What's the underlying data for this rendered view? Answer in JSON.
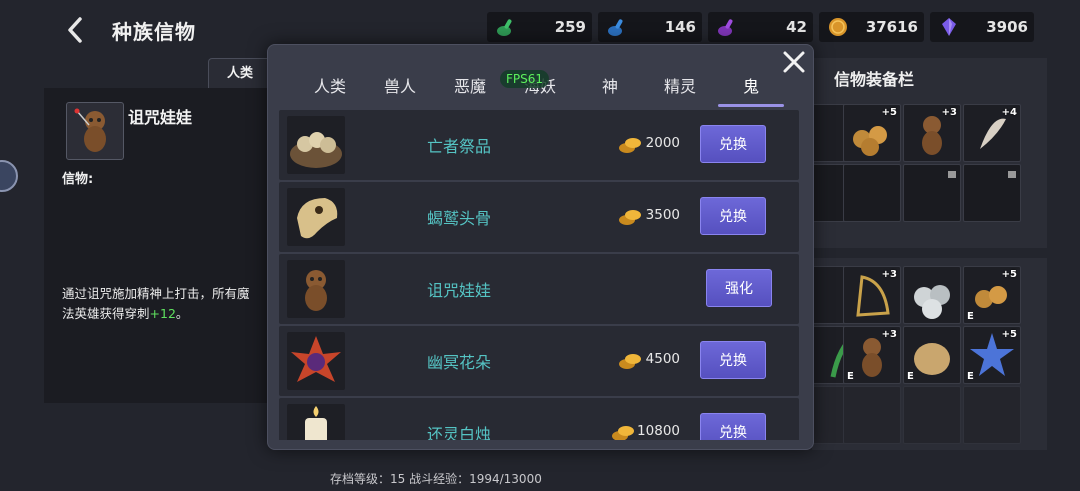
{
  "header": {
    "title": "种族信物"
  },
  "resources": [
    {
      "icon": "green-potion-icon",
      "value": "259",
      "color": "#3fbf6a"
    },
    {
      "icon": "blue-potion-icon",
      "value": "146",
      "color": "#3c8de0"
    },
    {
      "icon": "purple-potion-icon",
      "value": "42",
      "color": "#a04de0"
    },
    {
      "icon": "gold-coin-icon",
      "value": "37616",
      "color": "#d9952a"
    },
    {
      "icon": "purple-crystal-icon",
      "value": "3906",
      "color": "#7a5ce8"
    }
  ],
  "left": {
    "tab_label": "人类",
    "item_name": "诅咒娃娃",
    "label": "信物:",
    "description": "通过诅咒施加精神上打击，所有魔法英雄获得穿刺",
    "bonus": "+12",
    "desc_end": "。"
  },
  "right": {
    "equip_title": "信物装备栏",
    "equip_badges": [
      "+5",
      "+5",
      "+3",
      "+4"
    ],
    "inv_badges": [
      "+4",
      "+3",
      "",
      "+5",
      "",
      "+3",
      "",
      "+5"
    ],
    "inv_e_marks": [
      "",
      "",
      "",
      "E",
      "",
      "E",
      "E",
      "E"
    ]
  },
  "modal": {
    "tabs": [
      "人类",
      "兽人",
      "恶魔",
      "海妖",
      "神",
      "精灵",
      "鬼"
    ],
    "active_tab": "鬼",
    "fps_label": "FPS61",
    "items": [
      {
        "name": "亡者祭品",
        "price": "2000",
        "action": "兑换",
        "icon": "skull-bowl-icon"
      },
      {
        "name": "蝎鹫头骨",
        "price": "3500",
        "action": "兑换",
        "icon": "beast-skull-icon"
      },
      {
        "name": "诅咒娃娃",
        "price": "",
        "action": "强化",
        "icon": "voodoo-doll-icon"
      },
      {
        "name": "幽冥花朵",
        "price": "4500",
        "action": "兑换",
        "icon": "dark-flower-icon"
      },
      {
        "name": "还灵白烛",
        "price": "10800",
        "action": "兑换",
        "icon": "white-candle-icon"
      }
    ]
  },
  "footer": {
    "text": "存档等级：15  战斗经验：1994/13000"
  }
}
